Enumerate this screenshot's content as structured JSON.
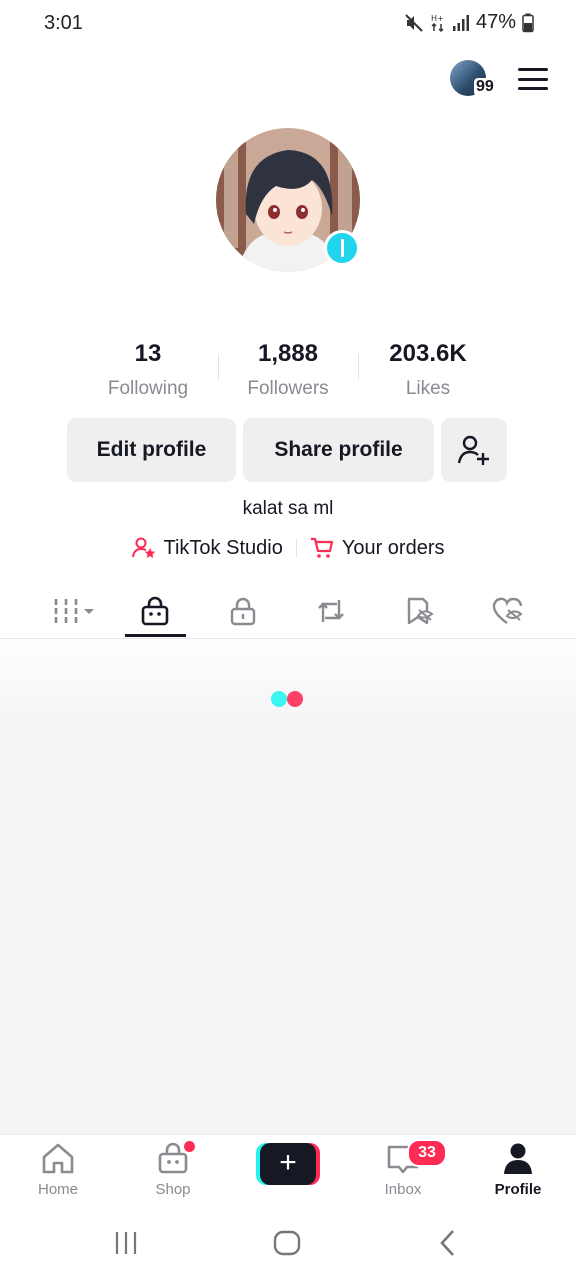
{
  "status_bar": {
    "time": "3:01",
    "battery": "47%",
    "icons": [
      "mute-icon",
      "data-icon",
      "signal-icon",
      "battery-icon"
    ]
  },
  "header": {
    "story_count": "99"
  },
  "profile": {
    "bio": "kalat sa ml"
  },
  "stats": [
    {
      "value": "13",
      "label": "Following"
    },
    {
      "value": "1,888",
      "label": "Followers"
    },
    {
      "value": "203.6K",
      "label": "Likes"
    }
  ],
  "buttons": {
    "edit": "Edit profile",
    "share": "Share profile"
  },
  "links": {
    "studio": "TikTok Studio",
    "orders": "Your orders"
  },
  "tabs": [
    "videos-grid-icon",
    "shop-bag-icon",
    "lock-icon",
    "repost-icon",
    "favorites-hidden-icon",
    "liked-hidden-icon"
  ],
  "nav": {
    "home": "Home",
    "shop": "Shop",
    "inbox": "Inbox",
    "inbox_badge": "33",
    "profile": "Profile"
  },
  "colors": {
    "accent_red": "#fe2c55",
    "accent_cyan": "#25f4ee",
    "text": "#161823",
    "muted": "#8a8b91"
  }
}
